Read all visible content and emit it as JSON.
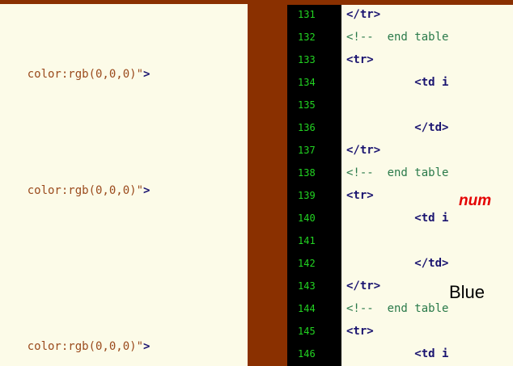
{
  "left_pane": {
    "lines": [
      {
        "text": "color:rgb(0,0,0)\"",
        "close": ">"
      },
      {
        "text": "color:rgb(0,0,0)\"",
        "close": ">"
      },
      {
        "text": "color:rgb(0,0,0)\"",
        "close": ">"
      }
    ]
  },
  "right_pane": {
    "gutter_numbers": [
      "131",
      "132",
      "133",
      "134",
      "135",
      "136",
      "137",
      "138",
      "139",
      "140",
      "141",
      "142",
      "143",
      "144",
      "145",
      "146"
    ],
    "code_lines": [
      {
        "n": "131",
        "text": "</tr>",
        "kind": "tag"
      },
      {
        "n": "132",
        "text": "<!--  end table",
        "kind": "comment"
      },
      {
        "n": "133",
        "text": "<tr>",
        "kind": "tag"
      },
      {
        "n": "134",
        "text": "          <td i",
        "kind": "tag"
      },
      {
        "n": "135",
        "text": "",
        "kind": "tag"
      },
      {
        "n": "136",
        "text": "          </td>",
        "kind": "tag"
      },
      {
        "n": "137",
        "text": "</tr>",
        "kind": "tag"
      },
      {
        "n": "138",
        "text": "<!--  end table",
        "kind": "comment"
      },
      {
        "n": "139",
        "text": "<tr>",
        "kind": "tag"
      },
      {
        "n": "140",
        "text": "          <td i",
        "kind": "tag"
      },
      {
        "n": "141",
        "text": "",
        "kind": "tag"
      },
      {
        "n": "142",
        "text": "          </td>",
        "kind": "tag"
      },
      {
        "n": "143",
        "text": "</tr>",
        "kind": "tag"
      },
      {
        "n": "144",
        "text": "<!--  end table",
        "kind": "comment"
      },
      {
        "n": "145",
        "text": "<tr>",
        "kind": "tag"
      },
      {
        "n": "146",
        "text": "          <td i",
        "kind": "tag"
      }
    ],
    "overlay_red_text": "num",
    "overlay_blue_text": "Blue"
  },
  "colors": {
    "background": "#8a3000",
    "editor_bg": "#fcfbe8",
    "gutter_bg": "#000000",
    "line_number": "#22d422",
    "tag": "#1a1470",
    "comment": "#2a7a4a",
    "attr_value": "#9a4a1c",
    "overlay_red": "#e40000"
  }
}
